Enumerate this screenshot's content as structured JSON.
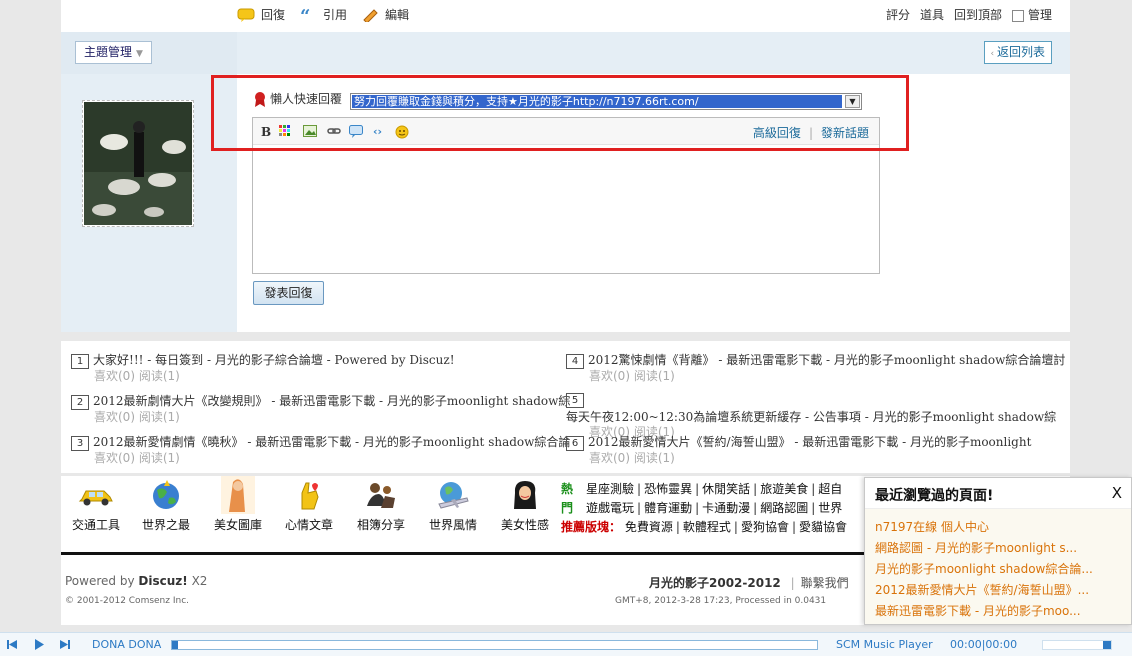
{
  "actions": {
    "reply": "回復",
    "quote": "引用",
    "edit": "編輯",
    "rate": "評分",
    "tools": "道具",
    "top": "回到頂部",
    "manage": "管理"
  },
  "topic_manage": "主題管理",
  "back_to_list": "返回列表",
  "quick_reply": {
    "label": "懶人快速回覆",
    "selected": "努力回覆賺取金錢與積分，支持★月光的影子http://n7197.66rt.com/",
    "advanced": "高級回復",
    "new_topic": "發新話題",
    "submit": "發表回復"
  },
  "related": [
    {
      "num": "1",
      "title": "大家好!!! - 每日簽到 - 月光的影子綜合論壇 - Powered by Discuz!",
      "meta": "喜欢(0) 阅读(1)"
    },
    {
      "num": "2",
      "title": "2012最新劇情大片《改變規則》 - 最新迅雷電影下載 - 月光的影子moonlight shadow綜",
      "meta": "喜欢(0) 阅读(1)"
    },
    {
      "num": "3",
      "title": "2012最新愛情劇情《曉秋》 - 最新迅雷電影下載 - 月光的影子moonlight shadow綜合論",
      "meta": "喜欢(0) 阅读(1)"
    },
    {
      "num": "4",
      "title": "2012驚悚劇情《背離》 - 最新迅雷電影下載 - 月光的影子moonlight shadow綜合論壇討",
      "meta": "喜欢(0) 阅读(1)"
    },
    {
      "num": "5",
      "title": "每天午夜12:00~12:30為論壇系統更新緩存 - 公告事項 - 月光的影子moonlight shadow綜",
      "meta": "喜欢(0) 阅读(1)"
    },
    {
      "num": "6",
      "title": "2012最新愛情大片《誓約/海誓山盟》 - 最新迅雷電影下載 - 月光的影子moonlight",
      "meta": "喜欢(0) 阅读(1)"
    }
  ],
  "categories": [
    "交通工具",
    "世界之最",
    "美女圖庫",
    "心情文章",
    "相簿分享",
    "世界風情",
    "美女性感"
  ],
  "hot_label": [
    "熱",
    "門"
  ],
  "hot_links_row1": [
    "星座測驗",
    "恐怖靈異",
    "休閒笑話",
    "旅遊美食",
    "超自"
  ],
  "hot_links_row2": [
    "遊戲電玩",
    "體育運動",
    "卡通動漫",
    "網路認圖",
    "世界"
  ],
  "recommend_label": "推薦版塊：",
  "hot_links_row3": [
    "免費資源",
    "軟體程式",
    "愛狗協會",
    "愛貓協會"
  ],
  "footer": {
    "powered": "Powered by",
    "discuz": "Discuz!",
    "version": "X2",
    "copyright": "© 2001-2012 Comsenz Inc.",
    "site": "月光的影子2002-2012",
    "contact": "聯繫我們",
    "gmt": "GMT+8, 2012-3-28 17:23, Processed in 0.0431"
  },
  "recent": {
    "title": "最近瀏覽過的頁面!",
    "close": "X",
    "items": [
      "n7197在線 個人中心",
      "網路認圖 - 月光的影子moonlight s...",
      "月光的影子moonlight shadow綜合論...",
      "2012最新愛情大片《誓約/海誓山盟》...",
      "最新迅雷電影下載 - 月光的影子moo..."
    ]
  },
  "player": {
    "track": "DONA DONA",
    "name": "SCM Music Player",
    "time": "00:00|00:00"
  },
  "colors": {
    "accent_blue": "#1b6a9a",
    "highlight_red": "#e02020",
    "recent_orange": "#d9730a"
  }
}
